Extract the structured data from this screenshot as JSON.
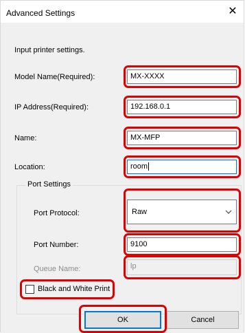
{
  "dialog": {
    "title": "Advanced Settings",
    "close_glyph": "✕",
    "instruction": "Input printer settings."
  },
  "fields": {
    "model_name": {
      "label": "Model Name(Required):",
      "value": "MX-XXXX"
    },
    "ip_address": {
      "label": "IP Address(Required):",
      "value": "192.168.0.1"
    },
    "name": {
      "label": "Name:",
      "value": "MX-MFP"
    },
    "location": {
      "label": "Location:",
      "value": "room"
    }
  },
  "port_settings": {
    "group_label": "Port Settings",
    "protocol": {
      "label": "Port Protocol:",
      "value": "Raw",
      "chevron_icon": "chevron-down-icon"
    },
    "port_number": {
      "label": "Port Number:",
      "value": "9100"
    },
    "queue_name": {
      "label": "Queue Name:",
      "value": "lp",
      "enabled": false
    }
  },
  "options": {
    "black_white": {
      "label": "Black and White Print",
      "checked": false
    }
  },
  "buttons": {
    "ok": "OK",
    "cancel": "Cancel"
  },
  "colors": {
    "highlight": "#e00000",
    "focus": "#0078d7",
    "client_bg": "#f0f0f0"
  }
}
